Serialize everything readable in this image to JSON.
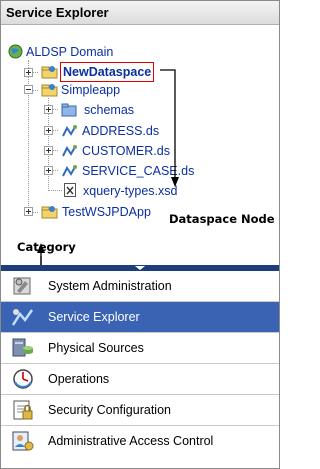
{
  "header": {
    "title": "Service Explorer"
  },
  "tree": {
    "root": "ALDSP Domain",
    "items": [
      {
        "label": "NewDataspace"
      },
      {
        "label": "Simpleapp"
      },
      {
        "label": "schemas"
      },
      {
        "label": "ADDRESS.ds"
      },
      {
        "label": "CUSTOMER.ds"
      },
      {
        "label": "SERVICE_CASE.ds"
      },
      {
        "label": "xquery-types.xsd"
      },
      {
        "label": "TestWSJPDApp"
      }
    ]
  },
  "annotations": {
    "dataspace_node": "Dataspace Node",
    "category": "Category"
  },
  "menu": {
    "items": [
      {
        "label": "System Administration",
        "icon": "system-admin-icon"
      },
      {
        "label": "Service Explorer",
        "icon": "service-explorer-icon",
        "selected": true
      },
      {
        "label": "Physical Sources",
        "icon": "physical-sources-icon"
      },
      {
        "label": "Operations",
        "icon": "operations-icon"
      },
      {
        "label": "Security Configuration",
        "icon": "security-config-icon"
      },
      {
        "label": "Administrative Access Control",
        "icon": "admin-access-icon"
      }
    ]
  },
  "colors": {
    "selected_bg": "#3a63b4",
    "link": "#0a2fa0",
    "highlight_border": "#dd0000",
    "divider": "#1c3f7a"
  }
}
